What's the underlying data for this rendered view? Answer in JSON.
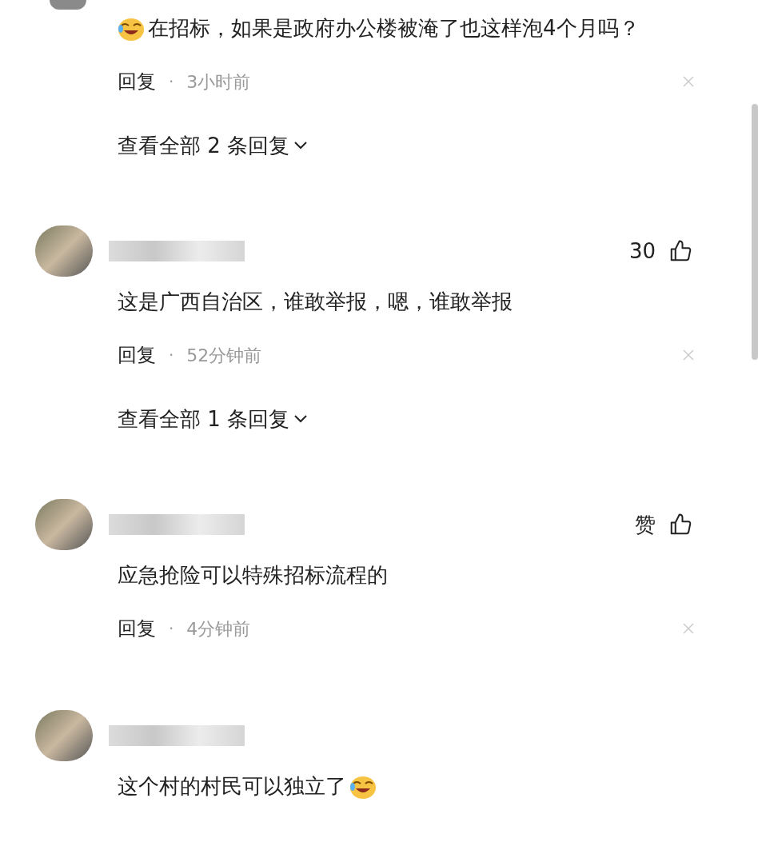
{
  "comments": [
    {
      "cut_top": true,
      "emoji_before": true,
      "emoji_after": false,
      "text": "在招标，如果是政府办公楼被淹了也这样泡4个月吗？",
      "reply": "回复",
      "dot": "·",
      "time": "3小时前",
      "view_replies": "查看全部 2 条回复"
    },
    {
      "cut_top": false,
      "likes": "30",
      "emoji_before": false,
      "emoji_after": false,
      "text": "这是广西自治区，谁敢举报，嗯，谁敢举报",
      "reply": "回复",
      "dot": "·",
      "time": "52分钟前",
      "view_replies": "查看全部 1 条回复"
    },
    {
      "cut_top": false,
      "likes": "赞",
      "emoji_before": false,
      "emoji_after": false,
      "text": "应急抢险可以特殊招标流程的",
      "reply": "回复",
      "dot": "·",
      "time": "4分钟前"
    },
    {
      "cut_top": false,
      "emoji_before": false,
      "emoji_after": true,
      "text": "这个村的村民可以独立了"
    }
  ]
}
